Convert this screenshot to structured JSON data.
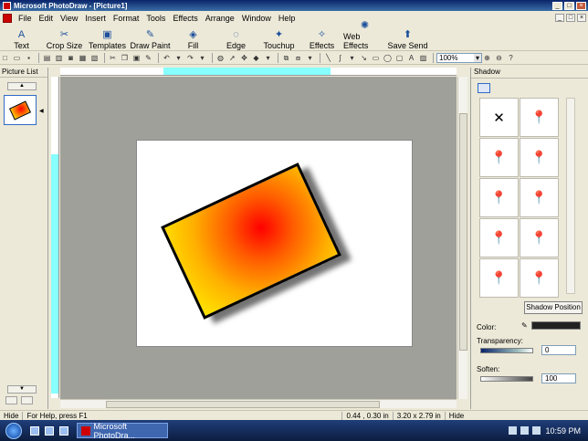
{
  "window": {
    "title": "Microsoft PhotoDraw - [Picture1]"
  },
  "menu": [
    "File",
    "Edit",
    "View",
    "Insert",
    "Format",
    "Tools",
    "Effects",
    "Arrange",
    "Window",
    "Help"
  ],
  "big_toolbar": [
    {
      "label": "Text",
      "icon": "text-icon"
    },
    {
      "label": "Crop Size",
      "icon": "crop-icon"
    },
    {
      "label": "Templates",
      "icon": "templates-icon"
    },
    {
      "label": "Draw Paint",
      "icon": "draw-paint-icon"
    },
    {
      "label": "Fill",
      "icon": "fill-icon"
    },
    {
      "label": "Edge",
      "icon": "edge-icon"
    },
    {
      "label": "Touchup",
      "icon": "touchup-icon"
    },
    {
      "label": "Effects",
      "icon": "effects-icon"
    },
    {
      "label": "Web Effects",
      "icon": "web-effects-icon"
    },
    {
      "label": "Save Send",
      "icon": "save-send-icon"
    }
  ],
  "zoom": "100%",
  "picture_list": {
    "title": "Picture List"
  },
  "shadow_panel": {
    "title": "Shadow",
    "position_button": "Shadow Position",
    "color_label": "Color:",
    "transparency_label": "Transparency:",
    "transparency_value": "0",
    "soften_label": "Soften:",
    "soften_value": "100"
  },
  "status": {
    "hide_left": "Hide",
    "help": "For Help, press F1",
    "coords": "0.44 , 0.30 in",
    "size": "3.20 x 2.79 in",
    "hide_right": "Hide"
  },
  "taskbar": {
    "task": "Microsoft PhotoDra...",
    "clock": "10:59 PM"
  }
}
